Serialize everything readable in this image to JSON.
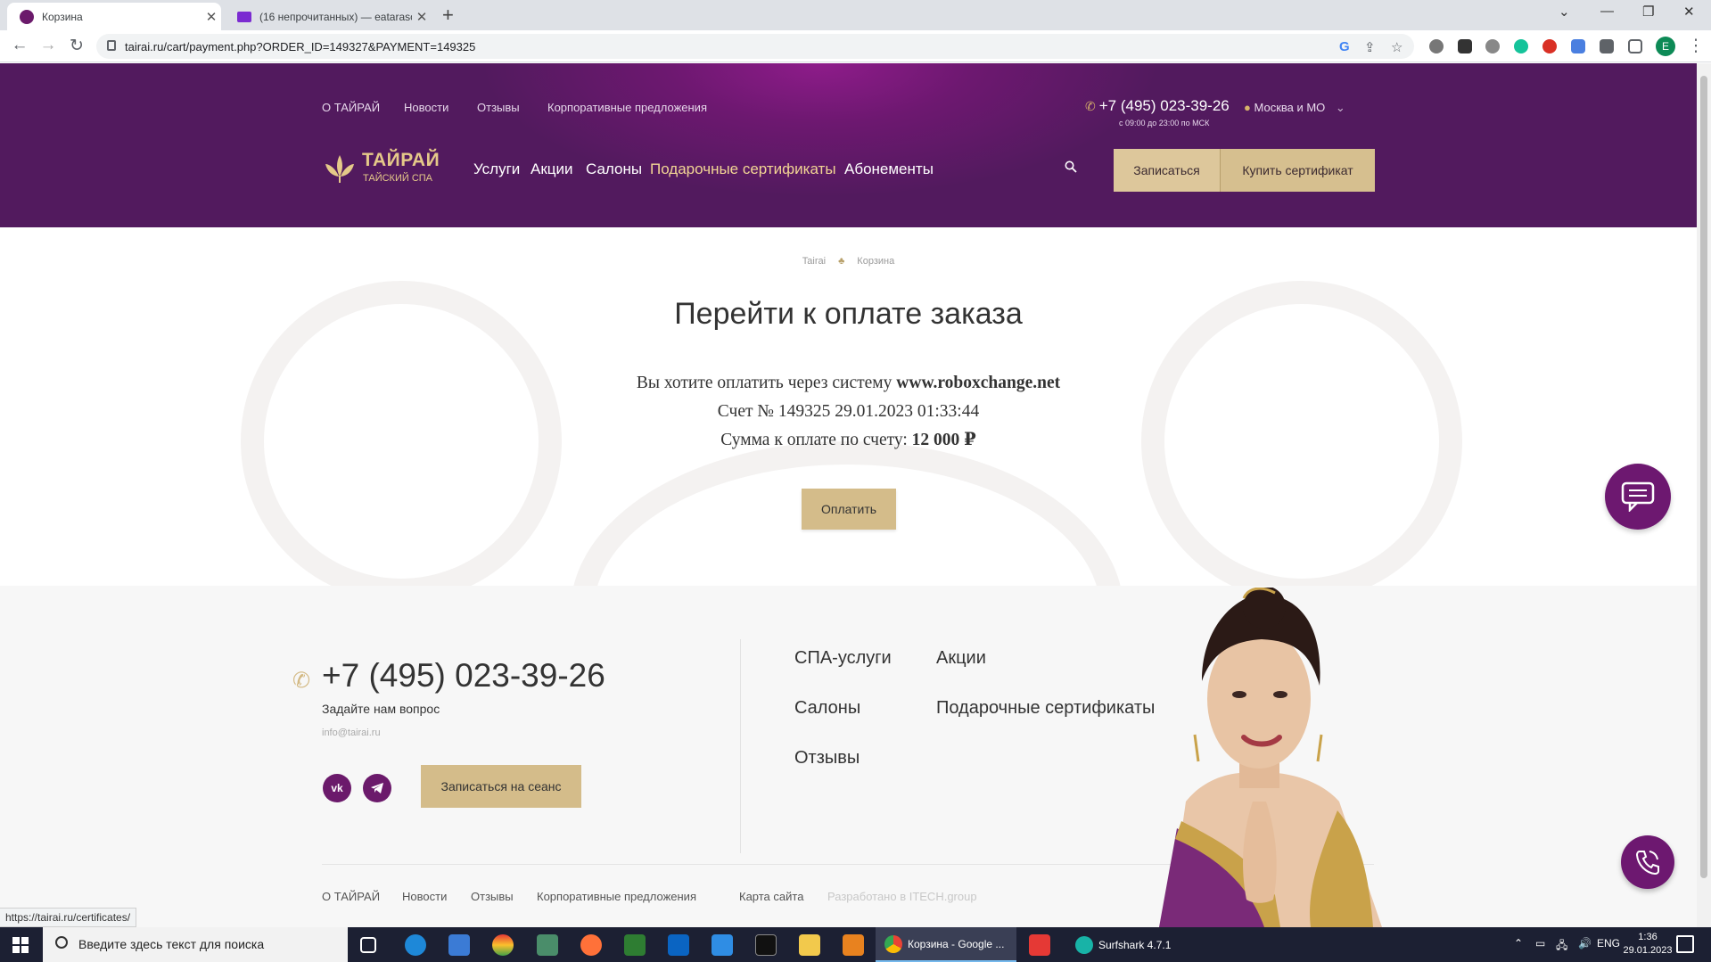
{
  "browser": {
    "tabs": [
      {
        "title": "Корзина",
        "active": true
      },
      {
        "title": "(16 непрочитанных) — eatarasc",
        "active": false
      }
    ],
    "new_tab": "+",
    "close_glyph": "✕",
    "url": "tairai.ru/cart/payment.php?ORDER_ID=149327&PAYMENT=149325",
    "profile_initial": "E",
    "window_controls": [
      "⌄",
      "—",
      "❐",
      "✕"
    ],
    "status_url": "https://tairai.ru/certificates/"
  },
  "header": {
    "top_nav": [
      "О ТАЙРАЙ",
      "Новости",
      "Отзывы",
      "Корпоративные предложения"
    ],
    "phone": "+7 (495) 023-39-26",
    "hours": "с 09:00 до 23:00 по МСК",
    "city": "Москва и МО",
    "logo_name": "ТАЙРАЙ",
    "logo_sub": "ТАЙСКИЙ СПА",
    "main_nav": [
      "Услуги",
      "Акции",
      "Салоны",
      "Подарочные сертификаты",
      "Абонементы"
    ],
    "btn_book": "Записаться",
    "btn_buy_cert": "Купить сертификат"
  },
  "breadcrumbs": [
    "Tairai",
    "Корзина"
  ],
  "main": {
    "title": "Перейти к оплате заказа",
    "pay_line1_prefix": "Вы хотите оплатить через систему ",
    "pay_system": "www.roboxchange.net",
    "invoice_line": "Счет № 149325 29.01.2023 01:33:44",
    "sum_prefix": "Сумма к оплате по счету: ",
    "sum_value": "12 000 ₽",
    "pay_button": "Оплатить"
  },
  "footer": {
    "phone": "+7 (495) 023-39-26",
    "ask": "Задайте нам вопрос",
    "email": "info@tairai.ru",
    "social": [
      "vk",
      "telegram"
    ],
    "book_button": "Записаться на сеанс",
    "links_col1": [
      "СПА-услуги",
      "Салоны",
      "Отзывы"
    ],
    "links_col2": [
      "Акции",
      "Подарочные сертификаты"
    ],
    "bottom_links": [
      "О ТАЙРАЙ",
      "Новости",
      "Отзывы",
      "Корпоративные предложения",
      "Карта сайта"
    ],
    "bottom_faded": "Разработано в ITECH.group"
  },
  "taskbar": {
    "search_placeholder": "Введите здесь текст для поиска",
    "apps": [
      {
        "label": "Корзина - Google ...",
        "active": true
      },
      {
        "label": "Surfshark 4.7.1",
        "active": false
      }
    ],
    "lang": "ENG",
    "time": "1:36",
    "date": "29.01.2023"
  },
  "colors": {
    "brand_purple": "#6d1870",
    "gold": "#d4bc8a",
    "gold_text": "#f2d594"
  }
}
